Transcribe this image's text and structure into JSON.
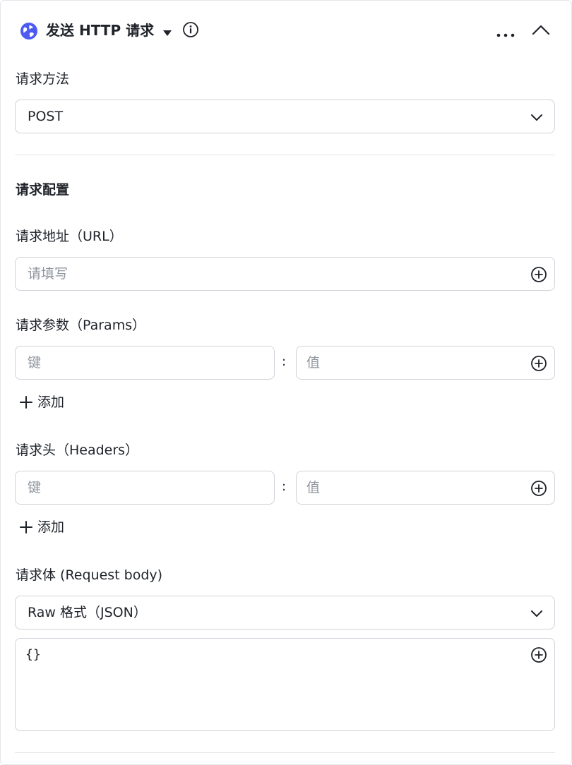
{
  "header": {
    "title": "发送 HTTP 请求",
    "icons": [
      "globe-icon",
      "caret-down-icon",
      "info-icon",
      "more-icon",
      "chevron-up-icon"
    ],
    "accent": "#4e5bf2"
  },
  "method": {
    "label": "请求方法",
    "value": "POST"
  },
  "config": {
    "title": "请求配置",
    "url": {
      "label": "请求地址（URL）",
      "placeholder": "请填写"
    },
    "params": {
      "label": "请求参数（Params）",
      "key_placeholder": "键",
      "colon": ":",
      "value_placeholder": "值",
      "add_label": "添加"
    },
    "headers": {
      "label": "请求头（Headers）",
      "key_placeholder": "键",
      "colon": ":",
      "value_placeholder": "值",
      "add_label": "添加"
    },
    "body": {
      "label": "请求体 (Request body)",
      "format": "Raw 格式（JSON）",
      "content": "{}"
    }
  }
}
